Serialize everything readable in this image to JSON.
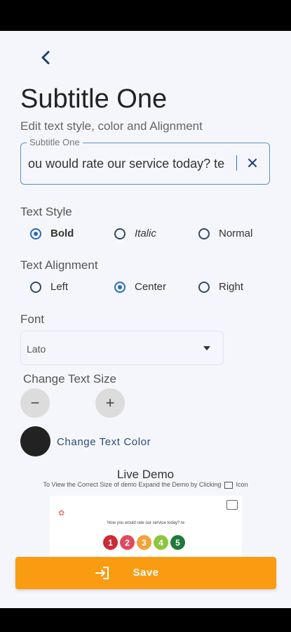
{
  "header": {
    "title": "Subtitle One",
    "description": "Edit text style, color and Alignment"
  },
  "subtitle_field": {
    "label": "Subtitle One",
    "value": "ou would rate our service today? te"
  },
  "text_style": {
    "label": "Text Style",
    "options": [
      "Bold",
      "Italic",
      "Normal"
    ],
    "selected": "Bold"
  },
  "text_alignment": {
    "label": "Text Alignment",
    "options": [
      "Left",
      "Center",
      "Right"
    ],
    "selected": "Center"
  },
  "font": {
    "label": "Font",
    "value": "Lato"
  },
  "text_size": {
    "label": "Change Text Size",
    "decrease": "−",
    "increase": "+"
  },
  "text_color": {
    "label": "Change Text Color",
    "color": "#222222"
  },
  "live_demo": {
    "title": "Live Demo",
    "hint_before": "To View the Correct Size of demo Expand the Demo by Clicking",
    "hint_after": "Icon",
    "question": "How you would rate our service today? te",
    "ratings": [
      {
        "label": "1",
        "color": "#cc2a36"
      },
      {
        "label": "2",
        "color": "#e04a5e"
      },
      {
        "label": "3",
        "color": "#f2a23a"
      },
      {
        "label": "4",
        "color": "#8cc63f"
      },
      {
        "label": "5",
        "color": "#1f7a3a"
      }
    ]
  },
  "save_button": {
    "label": "Save",
    "color": "#fa9c12"
  }
}
